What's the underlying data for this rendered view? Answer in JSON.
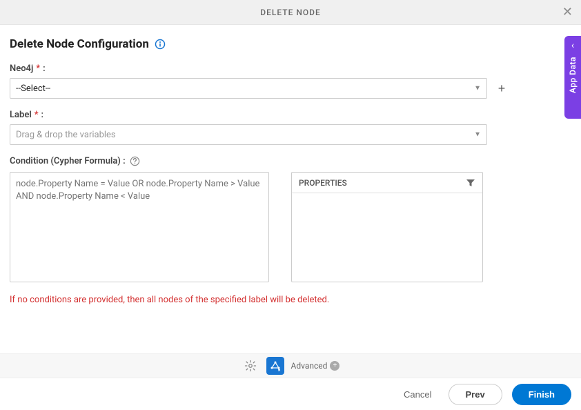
{
  "header": {
    "title": "DELETE NODE"
  },
  "page": {
    "title": "Delete Node Configuration"
  },
  "fields": {
    "neo4j": {
      "label": "Neo4j",
      "selected": "--Select--"
    },
    "label": {
      "label": "Label",
      "placeholder": "Drag & drop the variables"
    },
    "condition": {
      "label": "Condition (Cypher Formula) :",
      "placeholder": "node.Property Name = Value OR node.Property Name > Value AND node.Property Name < Value"
    },
    "properties": {
      "header": "PROPERTIES"
    }
  },
  "warning": "If no conditions are provided, then all nodes of the specified label will be deleted.",
  "toolbar": {
    "advanced": "Advanced"
  },
  "footer": {
    "cancel": "Cancel",
    "prev": "Prev",
    "finish": "Finish"
  },
  "sideTab": {
    "label": "App Data"
  }
}
